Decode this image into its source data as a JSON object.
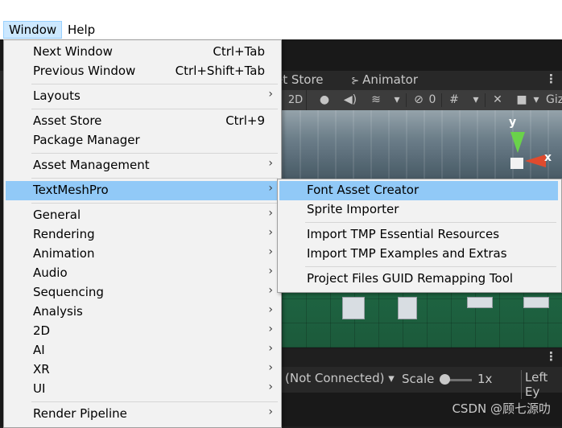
{
  "menubar": {
    "window": "Window",
    "help": "Help"
  },
  "editor": {
    "tab_asset_store": "et Store",
    "tab_animator": "Animator",
    "scene_2d": "2D",
    "hidden_count": "0",
    "gizmos": "Giz",
    "axis_y": "y",
    "axis_x": "x",
    "not_connected": "(Not Connected)",
    "scale_label": "Scale",
    "scale_value": "1x",
    "left_eye": "Left Ey"
  },
  "window_menu": {
    "next_window": "Next Window",
    "next_window_sc": "Ctrl+Tab",
    "previous_window": "Previous Window",
    "previous_window_sc": "Ctrl+Shift+Tab",
    "layouts": "Layouts",
    "asset_store": "Asset Store",
    "asset_store_sc": "Ctrl+9",
    "package_manager": "Package Manager",
    "asset_management": "Asset Management",
    "textmeshpro": "TextMeshPro",
    "general": "General",
    "rendering": "Rendering",
    "animation": "Animation",
    "audio": "Audio",
    "sequencing": "Sequencing",
    "analysis": "Analysis",
    "twod": "2D",
    "ai": "AI",
    "xr": "XR",
    "ui": "UI",
    "render_pipeline": "Render Pipeline"
  },
  "tmp_submenu": {
    "font_asset_creator": "Font Asset Creator",
    "sprite_importer": "Sprite Importer",
    "import_essential": "Import TMP Essential Resources",
    "import_examples": "Import TMP Examples and Extras",
    "guid_remap": "Project Files GUID Remapping Tool"
  },
  "watermark": "CSDN @顾七源叻",
  "colors": {
    "highlight": "#91c9f7",
    "menu_bg": "#f2f2f2",
    "menubar_active": "#cce8ff"
  }
}
